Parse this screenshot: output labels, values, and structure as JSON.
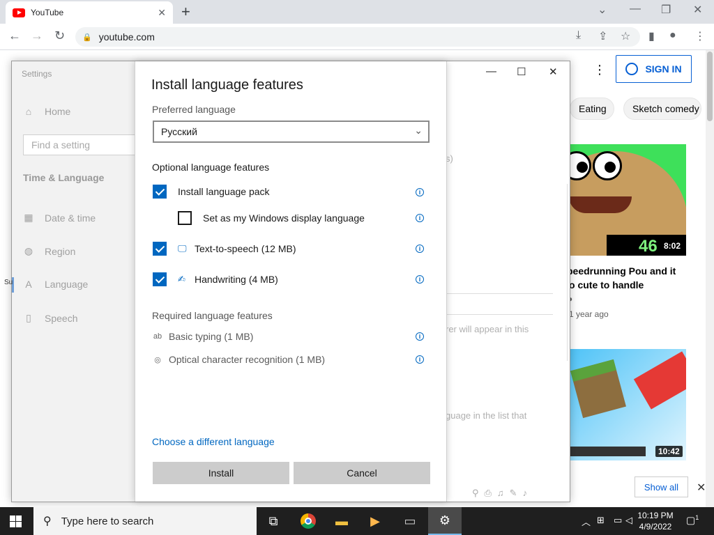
{
  "browser": {
    "tab_title": "YouTube",
    "url": "youtube.com"
  },
  "youtube": {
    "sign_in": "SIGN IN",
    "chips": [
      "Eating",
      "Sketch comedy"
    ],
    "video1_duration": "8:02",
    "video1_overlay": "46",
    "video1_title_lines": [
      "peedrunning Pou and it",
      "o cute to handle"
    ],
    "video1_meta": "1 year ago",
    "video2_duration": "10:42",
    "show_all": "Show all"
  },
  "settings": {
    "window_title": "Settings",
    "home": "Home",
    "search_placeholder": "Find a setting",
    "section": "Time & Language",
    "nav": [
      "Date & time",
      "Region",
      "Language",
      "Speech"
    ],
    "bg_text": {
      "paren": "s)",
      "line1": "rer will appear in this",
      "line2": "guage in the list that"
    }
  },
  "dialog": {
    "title": "Install language features",
    "preferred_label": "Preferred language",
    "preferred_value": "Русский",
    "optional_heading": "Optional language features",
    "optional": [
      {
        "label": "Install language pack",
        "checked": true
      },
      {
        "label": "Set as my Windows display language",
        "checked": false
      },
      {
        "label": "Text-to-speech (12 MB)",
        "checked": true
      },
      {
        "label": "Handwriting (4 MB)",
        "checked": true
      }
    ],
    "required_heading": "Required language features",
    "required": [
      "Basic typing (1 MB)",
      "Optical character recognition (1 MB)"
    ],
    "link": "Choose a different language",
    "install": "Install",
    "cancel": "Cancel"
  },
  "taskbar": {
    "search_placeholder": "Type here to search",
    "time": "10:19 PM",
    "date": "4/9/2022",
    "notification_count": "1"
  },
  "colors": {
    "accent": "#0067c0",
    "youtube_red": "#ff0000",
    "youtube_link": "#065fd4"
  }
}
